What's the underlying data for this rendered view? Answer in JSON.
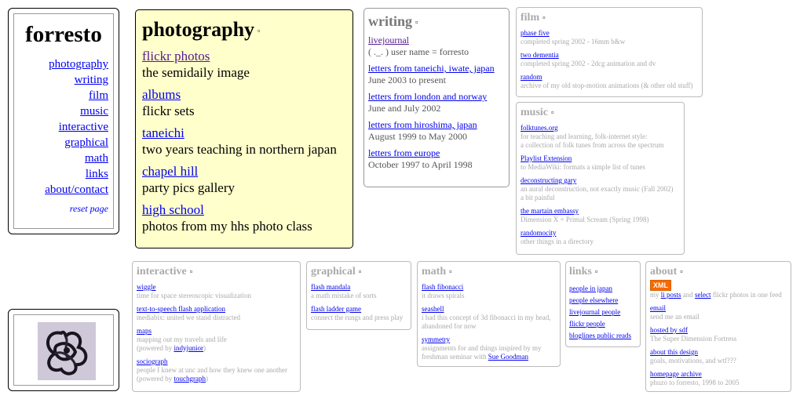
{
  "nav": {
    "title": "forresto",
    "items": [
      "photography",
      "writing",
      "film",
      "music",
      "interactive",
      "graphical",
      "math",
      "links",
      "about/contact"
    ],
    "reset": "reset page"
  },
  "photo": {
    "title": "photography",
    "star": "¤",
    "items": [
      {
        "link": "flickr photos",
        "desc": "the semidaily image"
      },
      {
        "link": "albums",
        "desc": "flickr sets"
      },
      {
        "link": "taneichi",
        "desc": "two years teaching in northern japan"
      },
      {
        "link": "chapel hill ",
        "desc": "party pics gallery"
      },
      {
        "link": "high school",
        "desc": "photos from my hhs photo class"
      }
    ]
  },
  "writing": {
    "title": "writing",
    "items": [
      {
        "link": "livejournal",
        "desc": "( ._. ) user name = forresto"
      },
      {
        "link": "letters from taneichi, iwate, japan",
        "desc": "June 2003 to present"
      },
      {
        "link": "letters from london and norway",
        "desc": "June and July 2002"
      },
      {
        "link": "letters from hiroshima, japan",
        "desc": "August 1999 to May 2000"
      },
      {
        "link": "letters from europe",
        "desc": "October 1997 to April 1998"
      }
    ]
  },
  "film": {
    "title": "film",
    "items": [
      {
        "link": "phase five",
        "desc": "completed spring 2002 - 16mm b&w"
      },
      {
        "link": "two dementia",
        "desc": "completed spring 2002 - 2dcg animation and dv"
      },
      {
        "link": "random",
        "desc": "archive of my old stop-motion animations (& other old stuff)"
      }
    ]
  },
  "music": {
    "title": "music",
    "items": [
      {
        "link": "folktunes.org",
        "desc": "for teaching and learning, folk-internet style:",
        "desc2": "a collection of folk tunes from across the spectrum"
      },
      {
        "link": "Playlist Extension",
        "desc": "to MediaWiki: formats a simple list of tunes"
      },
      {
        "link": "deconstructing gary",
        "desc": "an aural deconstruction, not exactly music (Fall 2002)",
        "desc2": "a bit painful"
      },
      {
        "link": "the martain embassy",
        "desc": "Dimension X + Primal Scream (Spring 1998)"
      },
      {
        "link": "randomocity",
        "desc": "other things in a directory"
      }
    ]
  },
  "interactive": {
    "title": "interactive",
    "items": [
      {
        "link": "wiggle",
        "desc": "time for space stereoscopic visualization"
      },
      {
        "link": "text-to-speech flash application",
        "desc": "mediabix: united we stand distracted"
      },
      {
        "link": "maps",
        "desc": "mapping out my travels and life",
        "desc2a": "(powered by ",
        "desc2link": "indyjunior",
        "desc2b": ")"
      },
      {
        "link": "sociograph",
        "desc": "people I knew at unc and how they knew one another",
        "desc2a": "(powered by ",
        "desc2link": "touchgraph",
        "desc2b": ")"
      }
    ]
  },
  "graphical": {
    "title": "graphical",
    "items": [
      {
        "link": "flash mandala",
        "desc": "a math mistake of sorts"
      },
      {
        "link": "flash ladder game",
        "desc": "connect the rungs and press play"
      }
    ]
  },
  "math": {
    "title": "math",
    "items": [
      {
        "link": "flash fibonacci",
        "desc": "it draws spirals"
      },
      {
        "link": "seashell",
        "desc": "i had this concept of 3d fibonacci in my head,",
        "desc2": "abandoned for now"
      },
      {
        "link": "symmetry",
        "desc": "assignments for and things inspired by my",
        "desc2a": "freshman seminar with ",
        "desc2link": "Sue Goodman"
      }
    ]
  },
  "links": {
    "title": "links",
    "items": [
      "people in japan",
      "people elsewhere",
      "livejournal people",
      "flickr people",
      "bloglines public reads"
    ]
  },
  "about": {
    "title": "about",
    "xml": "XML",
    "feed": {
      "a": "my ",
      "l1": "li posts",
      "b": " and ",
      "l2": "select",
      "c": " flickr photos in one feed"
    },
    "items": [
      {
        "link": "email",
        "desc": "send me an email"
      },
      {
        "link": "hosted by sdf",
        "desc": "The Super Dimension Fortress"
      },
      {
        "link": "about this design",
        "desc": "goals, motivations, and wtf???"
      },
      {
        "link": "homepage archive",
        "desc": "phuzo to forresto, 1998 to 2005"
      }
    ]
  },
  "colors": {
    "photo_bg": "#ffffcc",
    "link": "#0000ee",
    "xml_badge": "#ff6600"
  },
  "icons": {
    "star": "small-star-icon"
  }
}
